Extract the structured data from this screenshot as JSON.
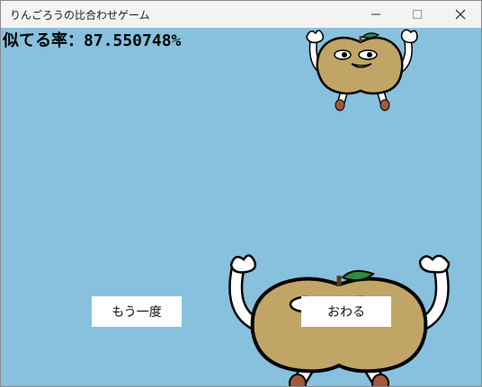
{
  "window": {
    "title": "りんごろうの比合わせゲーム"
  },
  "game": {
    "score_label": "似てる率：",
    "score_value": "87.550748%"
  },
  "buttons": {
    "again_label": "もう一度",
    "end_label": "おわる"
  },
  "colors": {
    "background": "#87c1de",
    "apple_body": "#c0a566",
    "apple_leaf": "#2f8a3e"
  },
  "icons": {
    "minimize": "minimize-icon",
    "maximize": "maximize-icon",
    "close": "close-icon"
  }
}
